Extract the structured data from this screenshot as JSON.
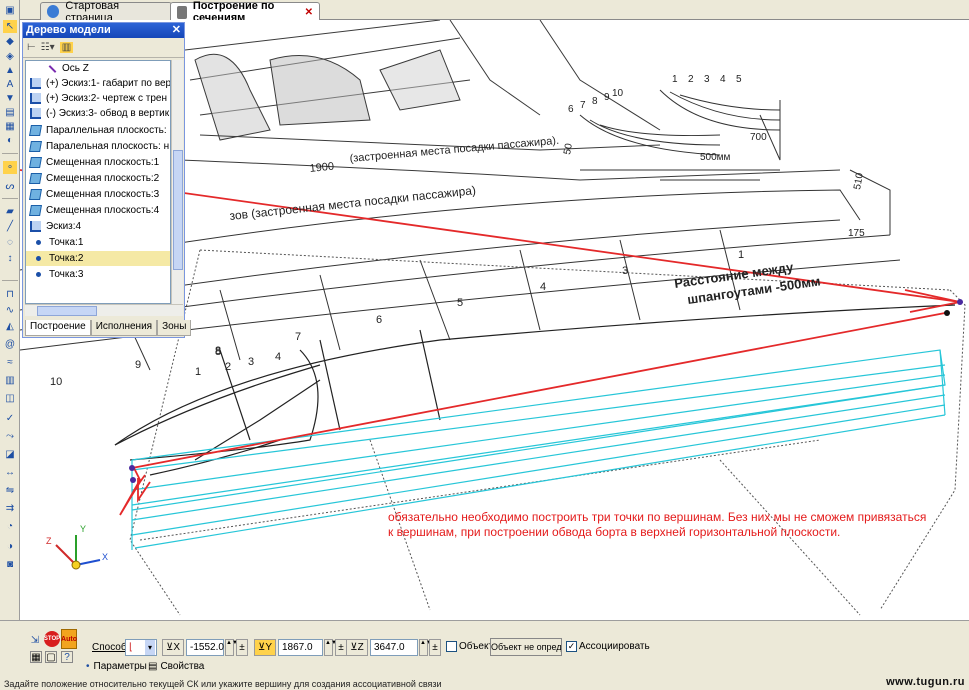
{
  "tabs": [
    {
      "label": "Стартовая страница",
      "active": false
    },
    {
      "label": "Построение по сечениям",
      "active": true
    }
  ],
  "tree": {
    "title": "Дерево модели",
    "items": [
      {
        "label": "Ось Z",
        "icon": "axis-icon"
      },
      {
        "label": "(+) Эскиз:1- габарит по вер",
        "icon": "sketch-icon"
      },
      {
        "label": "(+) Эскиз:2- чертеж с трен",
        "icon": "sketch-icon"
      },
      {
        "label": "(-) Эскиз:3- обвод в вертик",
        "icon": "sketch-icon"
      },
      {
        "label": "Параллельная плоскость: в",
        "icon": "plane-icon"
      },
      {
        "label": "Паралельная плоскость: н",
        "icon": "plane-icon"
      },
      {
        "label": "Смещенная плоскость:1",
        "icon": "plane-icon"
      },
      {
        "label": "Смещенная плоскость:2",
        "icon": "plane-icon"
      },
      {
        "label": "Смещенная плоскость:3",
        "icon": "plane-icon"
      },
      {
        "label": "Смещенная плоскость:4",
        "icon": "plane-icon"
      },
      {
        "label": "Эскиз:4",
        "icon": "sketch-icon"
      },
      {
        "label": "Точка:1",
        "icon": "point-icon"
      },
      {
        "label": "Точка:2",
        "icon": "point-icon",
        "selected": true
      },
      {
        "label": "Точка:3",
        "icon": "point-icon"
      }
    ],
    "bottom_tabs": [
      "Построение",
      "Исполнения",
      "Зоны"
    ]
  },
  "drawing": {
    "dimension_labels": [
      "1900",
      "500мм",
      "700",
      "510",
      "175",
      "50"
    ],
    "station_numbers_profile": [
      "1",
      "2",
      "3",
      "4",
      "5",
      "6",
      "7",
      "8",
      "9",
      "10"
    ],
    "section_numbers": [
      "1",
      "2",
      "3",
      "4",
      "5",
      "6",
      "7",
      "8",
      "9",
      "10"
    ],
    "caption_top": "(застроенная места посадки пассажира).",
    "caption_side": "зов (застроенная места посадки пассажира)",
    "station_note_line1": "Расстояние между",
    "station_note_line2": "шпангоутами -500мм",
    "axis_x": "X",
    "axis_y": "Y",
    "axis_z": "Z"
  },
  "annotation": {
    "line1": "обязательно необходимо построить три точки по вершинам. Без них мы не сможем привязаться",
    "line2": "к вершинам, при построении обвода борта в верхней горизонтальной плоскости."
  },
  "props": {
    "method_label": "Способ",
    "x_value": "-1552.0",
    "y_value": "1867.0",
    "z_value": "3647.0",
    "object_label": "Объект",
    "object_undefined_button": "Объект не опред",
    "associate_label": "Ассоциировать",
    "associate_checked": true,
    "auto_label": "Auto",
    "stop_label": "STOP",
    "tab_params": "Параметры",
    "tab_properties": "Свойства"
  },
  "status": {
    "text": "Задайте положение относительно текущей СК или укажите вершину для создания ассоциативной связи"
  },
  "watermark": "www.tugun.ru",
  "colors": {
    "red_line": "#e4292a",
    "cyan_line": "#27c6d8",
    "tree_title": "#1546b8"
  }
}
